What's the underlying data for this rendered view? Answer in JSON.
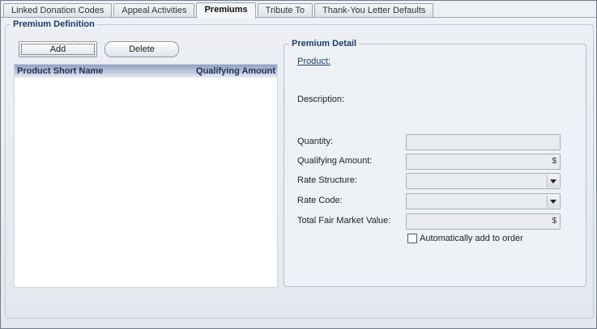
{
  "tabs": [
    {
      "label": "Linked Donation Codes",
      "active": false
    },
    {
      "label": "Appeal Activities",
      "active": false
    },
    {
      "label": "Premiums",
      "active": true
    },
    {
      "label": "Tribute To",
      "active": false
    },
    {
      "label": "Thank-You Letter Defaults",
      "active": false
    }
  ],
  "premium_definition": {
    "title": "Premium Definition",
    "add_label": "Add",
    "delete_label": "Delete",
    "grid": {
      "columns": [
        "Product Short Name",
        "Qualifying Amount"
      ],
      "rows": []
    }
  },
  "premium_detail": {
    "title": "Premium Detail",
    "product_label": "Product:",
    "description_label": "Description:",
    "quantity_label": "Quantity:",
    "qualifying_amount_label": "Qualifying Amount:",
    "rate_structure_label": "Rate Structure:",
    "rate_code_label": "Rate Code:",
    "total_fmv_label": "Total Fair Market Value:",
    "currency_symbol": "$",
    "auto_add_label": "Automatically add to order",
    "auto_add_checked": false
  }
}
